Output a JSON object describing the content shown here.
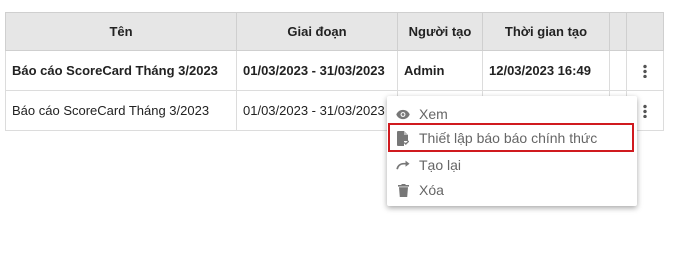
{
  "table": {
    "headers": [
      "Tên",
      "Giai đoạn",
      "Người tạo",
      "Thời gian tạo",
      "",
      ""
    ],
    "rows": [
      {
        "name": "Báo cáo ScoreCard Tháng 3/2023",
        "period": "01/03/2023 - 31/03/2023",
        "creator": "Admin",
        "created_at": "12/03/2023 16:49"
      },
      {
        "name": "Báo cáo ScoreCard Tháng 3/2023",
        "period": "01/03/2023 - 31/03/2023",
        "creator": "",
        "created_at": ""
      }
    ]
  },
  "context_menu": {
    "items": [
      {
        "label": "Xem",
        "icon": "eye-icon"
      },
      {
        "label": "Thiết lập báo báo chính thức",
        "icon": "document-check-icon"
      },
      {
        "label": "Tạo lại",
        "icon": "redo-icon"
      },
      {
        "label": "Xóa",
        "icon": "trash-icon"
      }
    ],
    "highlight_color": "#d01a1f"
  }
}
